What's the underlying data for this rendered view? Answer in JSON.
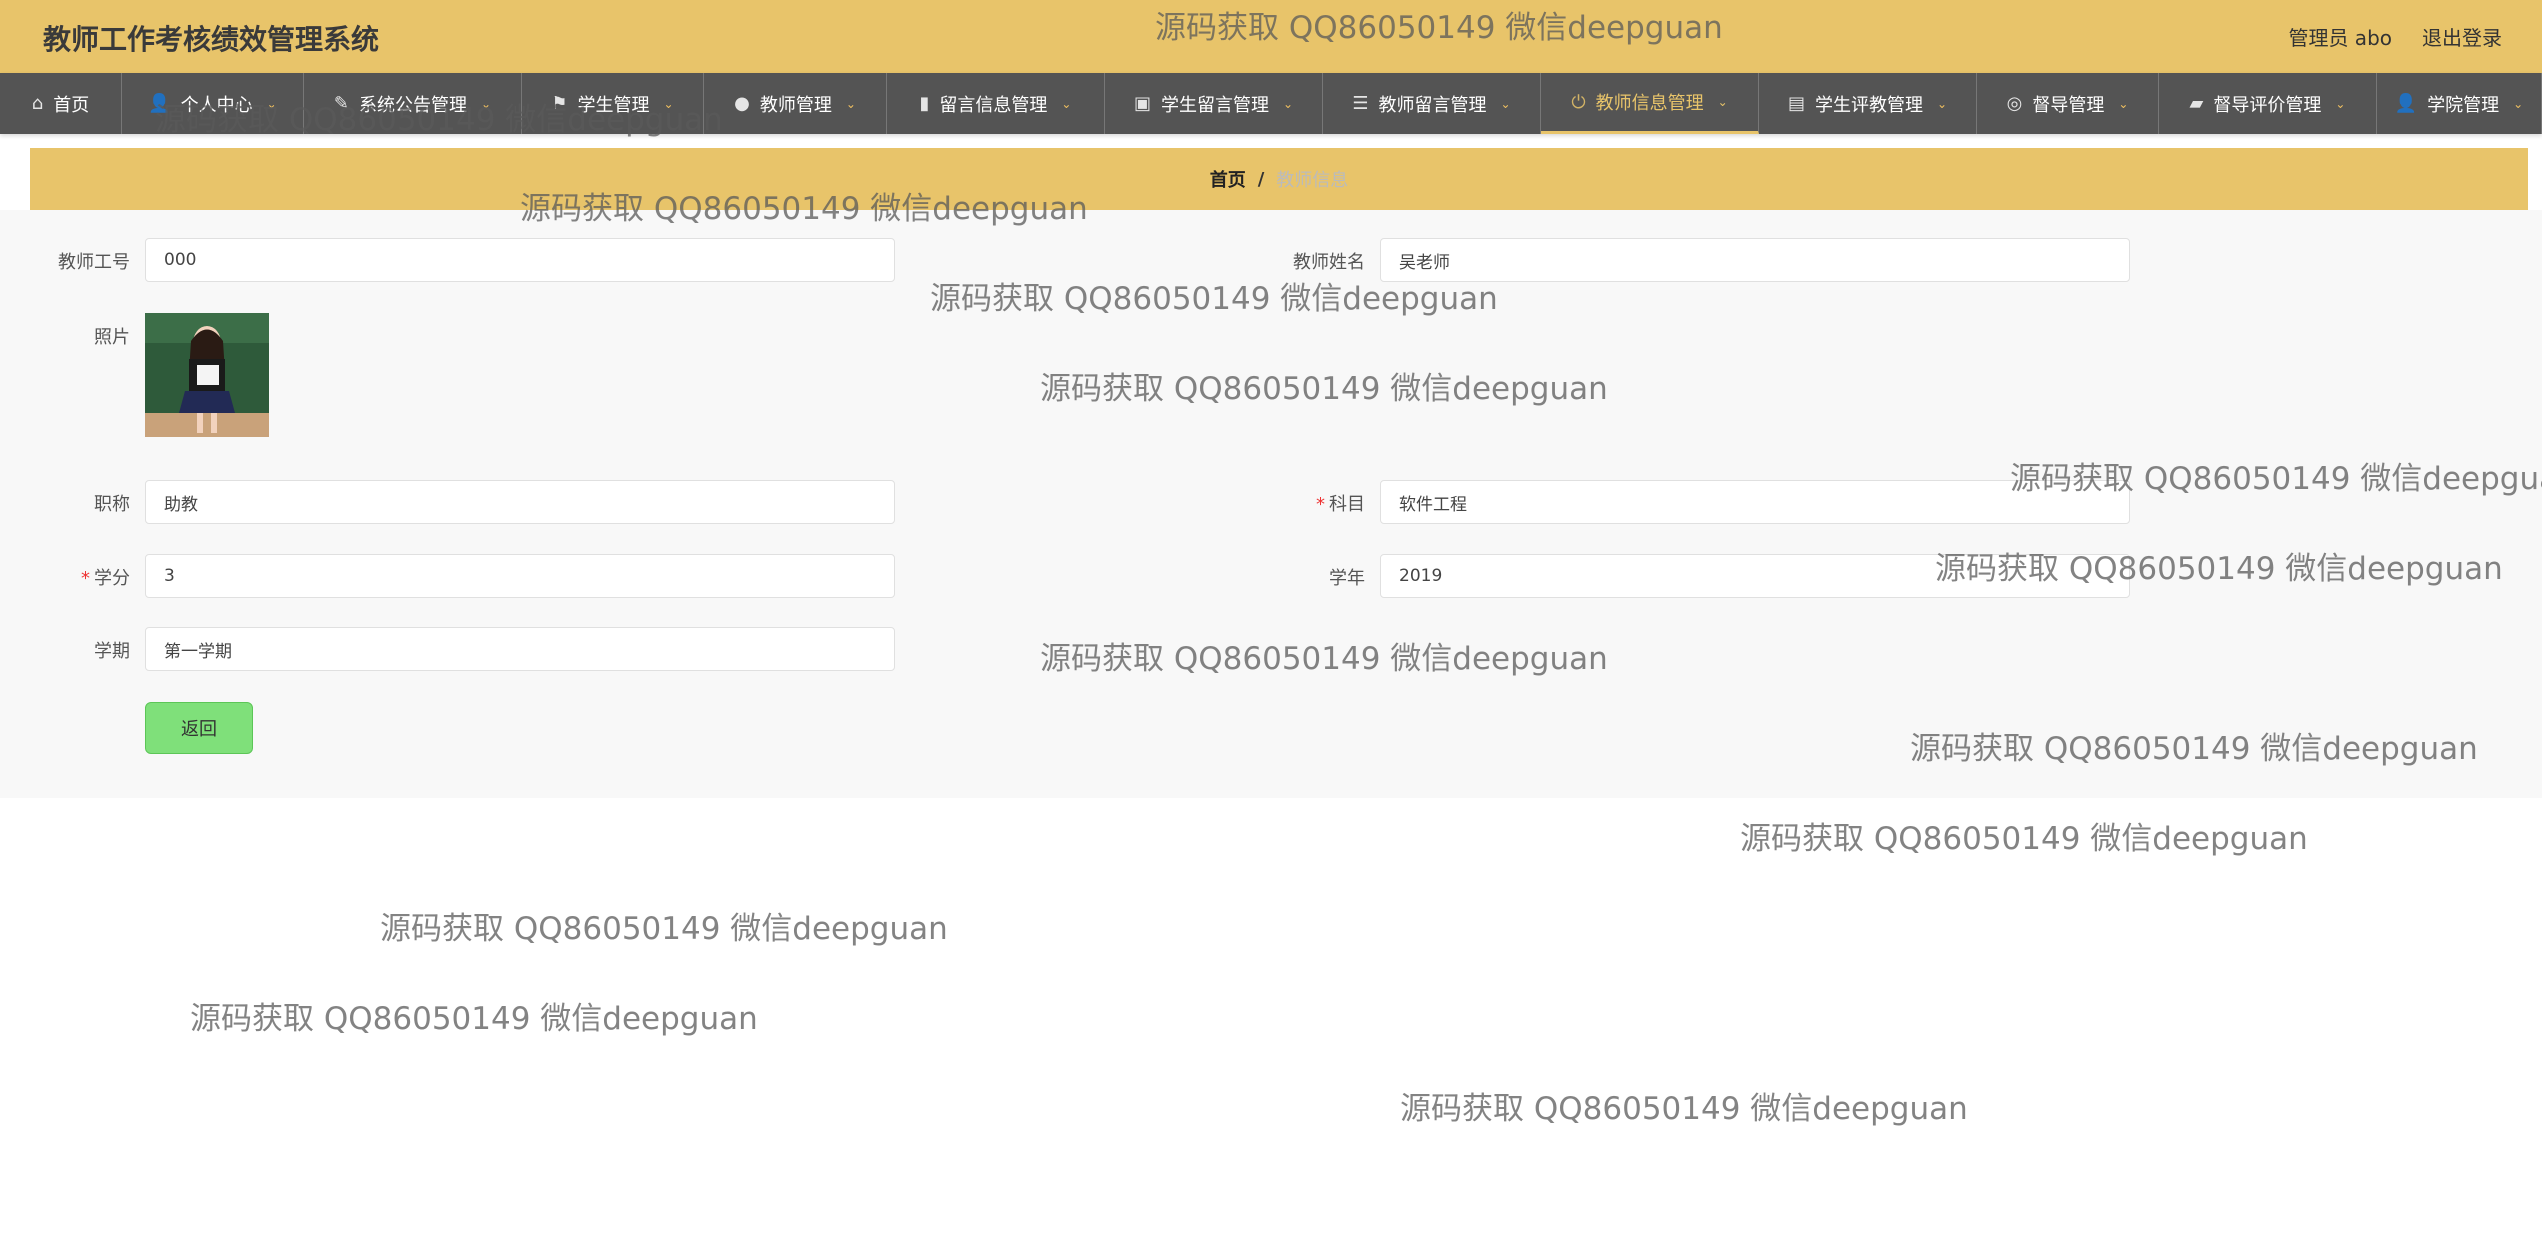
{
  "app": {
    "title": "教师工作考核绩效管理系统",
    "user_label": "管理员 abo",
    "logout_label": "退出登录"
  },
  "nav": {
    "items": [
      {
        "label": "首页",
        "icon": "home-icon"
      },
      {
        "label": "个人中心",
        "icon": "user-icon"
      },
      {
        "label": "系统公告管理",
        "icon": "notice-icon"
      },
      {
        "label": "学生管理",
        "icon": "flag-icon"
      },
      {
        "label": "教师管理",
        "icon": "location-icon"
      },
      {
        "label": "留言信息管理",
        "icon": "chart-icon"
      },
      {
        "label": "学生留言管理",
        "icon": "clipboard-icon"
      },
      {
        "label": "教师留言管理",
        "icon": "list-icon"
      },
      {
        "label": "教师信息管理",
        "icon": "power-icon"
      },
      {
        "label": "学生评教管理",
        "icon": "printer-icon"
      },
      {
        "label": "督导管理",
        "icon": "lifebuoy-icon"
      },
      {
        "label": "督导评价管理",
        "icon": "folder-icon"
      },
      {
        "label": "学院管理",
        "icon": "person-icon"
      }
    ],
    "active_index": 8
  },
  "breadcrumb": {
    "home": "首页",
    "separator": "/",
    "current": "教师信息"
  },
  "form": {
    "teacher_id": {
      "label": "教师工号",
      "value": "000"
    },
    "teacher_name": {
      "label": "教师姓名",
      "value": "吴老师"
    },
    "photo": {
      "label": "照片"
    },
    "title": {
      "label": "职称",
      "value": "助教"
    },
    "subject": {
      "label": "科目",
      "value": "软件工程",
      "required": true
    },
    "credit": {
      "label": "学分",
      "value": "3",
      "required": true
    },
    "year": {
      "label": "学年",
      "value": "2019"
    },
    "semester": {
      "label": "学期",
      "value": "第一学期"
    },
    "back_label": "返回"
  },
  "watermark": {
    "text": "源码获取 QQ86050149 微信deepguan"
  },
  "colors": {
    "accent": "#e8c46a",
    "nav_bg": "#545454",
    "button_green": "#7fe07a",
    "required": "#e33"
  }
}
